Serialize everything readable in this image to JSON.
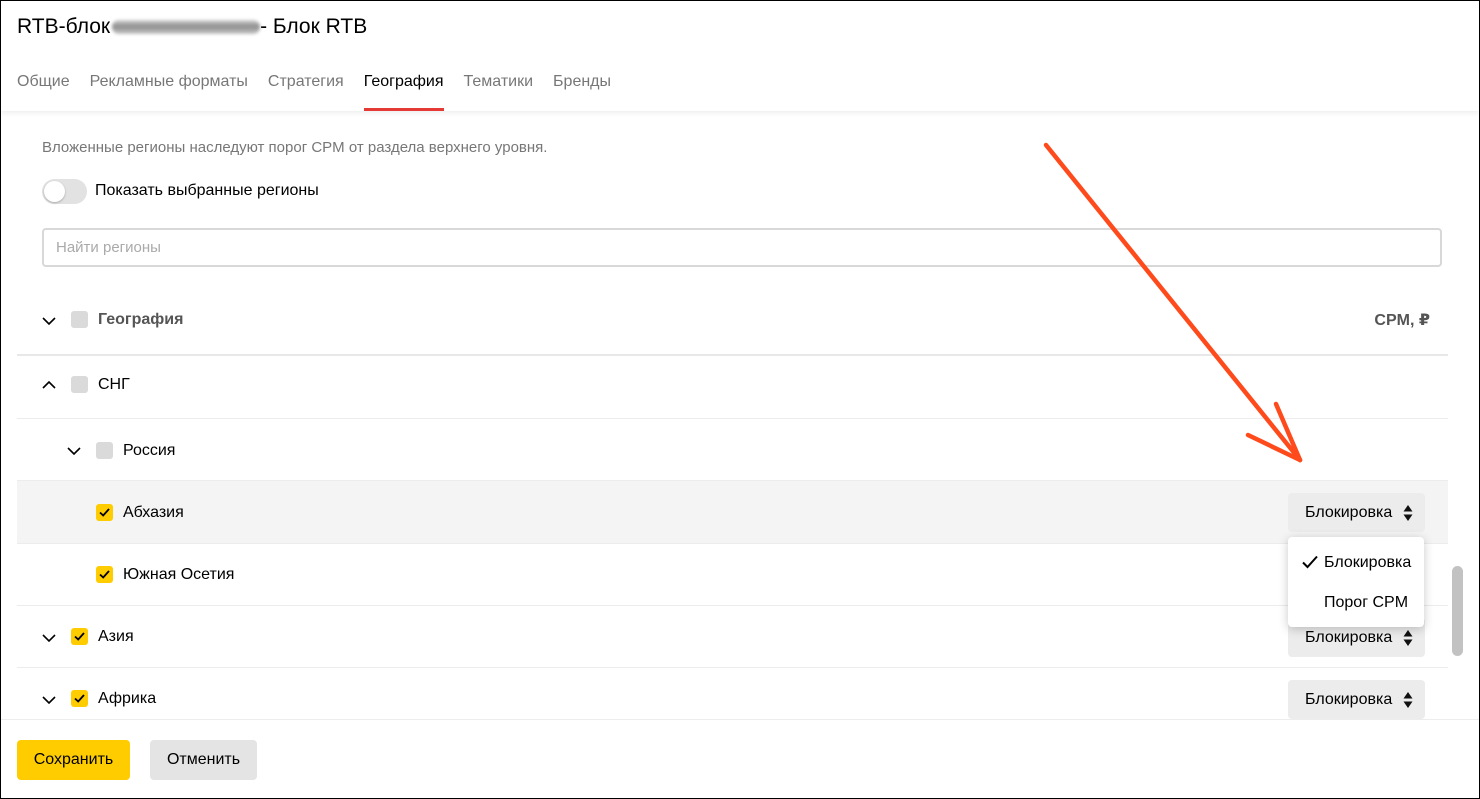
{
  "header": {
    "title_prefix": "RTB-блок",
    "title_suffix": "- Блок RTB",
    "tabs": [
      {
        "label": "Общие"
      },
      {
        "label": "Рекламные форматы"
      },
      {
        "label": "Стратегия"
      },
      {
        "label": "География",
        "active": true
      },
      {
        "label": "Тематики"
      },
      {
        "label": "Бренды"
      }
    ]
  },
  "main": {
    "note": "Вложенные регионы наследуют порог CPM от раздела верхнего уровня.",
    "toggle_label": "Показать выбранные регионы",
    "toggle_on": false,
    "search_placeholder": "Найти регионы",
    "search_value": "",
    "table_header": {
      "label": "География",
      "cpm_header": "CPM, ₽"
    },
    "rows": [
      {
        "label": "СНГ",
        "checked": false,
        "expanded": true
      },
      {
        "label": "Россия",
        "checked": false,
        "expanded": false
      },
      {
        "label": "Абхазия",
        "checked": true,
        "select": "Блокировка"
      },
      {
        "label": "Южная Осетия",
        "checked": true
      },
      {
        "label": "Азия",
        "checked": true,
        "expanded": false,
        "select": "Блокировка"
      },
      {
        "label": "Африка",
        "checked": true,
        "expanded": false,
        "select": "Блокировка"
      }
    ],
    "dropdown": {
      "options": [
        {
          "label": "Блокировка",
          "selected": true
        },
        {
          "label": "Порог CPM",
          "selected": false
        }
      ]
    }
  },
  "footer": {
    "save_label": "Сохранить",
    "cancel_label": "Отменить"
  },
  "colors": {
    "accent": "#ffcc00",
    "tab_underline": "#e53935",
    "annotation_arrow": "#ff4a1c"
  }
}
